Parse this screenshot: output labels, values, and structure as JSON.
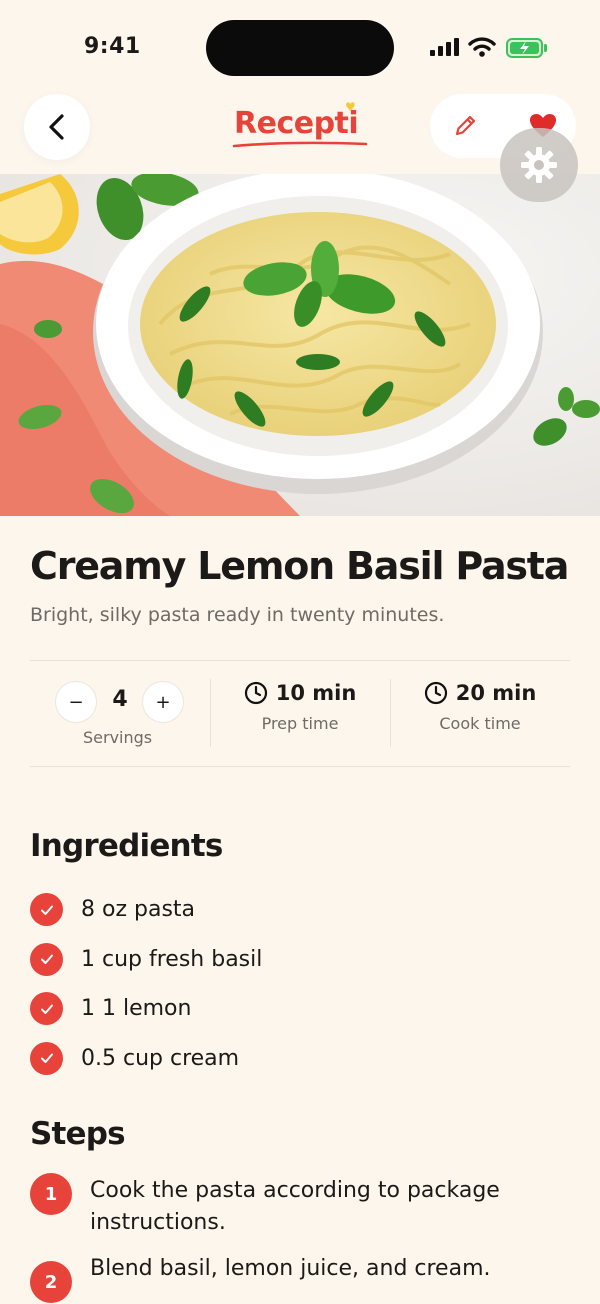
{
  "status_bar": {
    "time": "9:41"
  },
  "header": {
    "logo_text": "Recepti",
    "back_icon": "chevron-left-icon",
    "edit_icon": "pencil-icon",
    "favorite_icon": "heart-icon",
    "settings_icon": "gear-icon"
  },
  "recipe": {
    "title": "Creamy Lemon Basil Pasta",
    "subtitle": "Bright, silky pasta ready in twenty minutes.",
    "servings": {
      "value": "4",
      "label": "Servings",
      "minus": "−",
      "plus": "+"
    },
    "prep": {
      "value": "10 min",
      "label": "Prep time"
    },
    "cook": {
      "value": "20 min",
      "label": "Cook time"
    }
  },
  "ingredients": {
    "heading": "Ingredients",
    "items": [
      "8 oz pasta",
      "1 cup fresh basil",
      "1 1 lemon",
      "0.5 cup cream"
    ]
  },
  "steps": {
    "heading": "Steps",
    "items": [
      {
        "num": "1",
        "text": "Cook the pasta according to package instructions."
      },
      {
        "num": "2",
        "text": "Blend basil, lemon juice, and cream."
      }
    ]
  },
  "colors": {
    "accent": "#e8433a",
    "background": "#fdf6ed"
  }
}
